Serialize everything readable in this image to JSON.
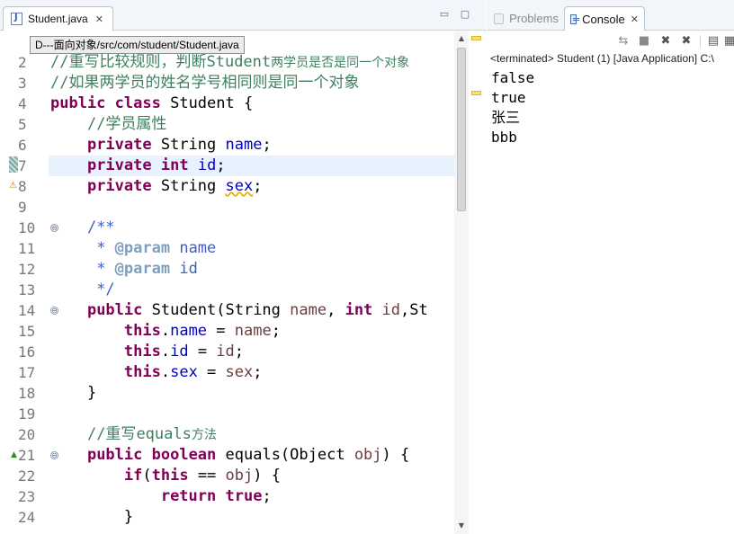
{
  "editor": {
    "tab": {
      "label": "Student.java",
      "close": "✕"
    },
    "controls": {
      "minimize": "▭",
      "maximize": "▢"
    },
    "tooltip": "D---面向对象/src/com/student/Student.java",
    "line_numbers": [
      "2",
      "3",
      "4",
      "5",
      "6",
      "7",
      "8",
      "9",
      "10",
      "11",
      "12",
      "13",
      "14",
      "15",
      "16",
      "17",
      "18",
      "19",
      "20",
      "21",
      "22",
      "23",
      "24"
    ],
    "lines": {
      "l2": {
        "slashes": "//",
        "a": "重写比较规则，判断",
        "b": "Student",
        "c": "两学员是否是同一个对象"
      },
      "l3": {
        "text": "//如果两学员的姓名学号相同则是同一个对象"
      },
      "l4": {
        "kw1": "public",
        "kw2": "class",
        "rest": " Student {"
      },
      "l5": {
        "text": "//学员属性"
      },
      "l6": {
        "kw": "private",
        "type": " String ",
        "field": "name",
        "end": ";"
      },
      "l7": {
        "kw1": "private",
        "kw2": "int",
        "field": "id",
        "end": ";"
      },
      "l8": {
        "kw": "private",
        "type": " String ",
        "field": "sex",
        "end": ";"
      },
      "l10": {
        "text": "/**"
      },
      "l11": {
        "star": " * ",
        "tag": "@param",
        "rest": " name"
      },
      "l12": {
        "star": " * ",
        "tag": "@param",
        "rest": " id"
      },
      "l13": {
        "text": " */"
      },
      "l14": {
        "kw": "public",
        "a": " Student(String ",
        "p1": "name",
        "b": ", ",
        "kw2": "int",
        "c": " ",
        "p2": "id",
        "d": ",St"
      },
      "l15": {
        "kw": "this",
        "dot": ".",
        "field": "name",
        "eq": " = ",
        "prm": "name",
        "end": ";"
      },
      "l16": {
        "kw": "this",
        "dot": ".",
        "field": "id",
        "eq": " = ",
        "prm": "id",
        "end": ";"
      },
      "l17": {
        "kw": "this",
        "dot": ".",
        "field": "sex",
        "eq": " = ",
        "prm": "sex",
        "end": ";"
      },
      "l18": {
        "text": "}"
      },
      "l20": {
        "a": "//重写",
        "b": "equals",
        "c": "方法"
      },
      "l21": {
        "kw1": "public",
        "kw2": "boolean",
        "a": " equals(Object ",
        "p": "obj",
        "b": ") {"
      },
      "l22": {
        "kw1": "if",
        "a": "(",
        "kw2": "this",
        "b": " == ",
        "p": "obj",
        "c": ") {"
      },
      "l23": {
        "kw1": "return",
        "kw2": "true",
        "end": ";"
      },
      "l24": {
        "text": "}"
      }
    }
  },
  "console": {
    "tabs": [
      {
        "label": "Problems"
      },
      {
        "label": "Console",
        "close": "✕"
      }
    ],
    "status": "<terminated> Student (1) [Java Application] C:\\",
    "output": [
      "false",
      "true",
      "张三",
      "bbb"
    ]
  },
  "icons": {
    "fold": "⊖",
    "override": "▲",
    "warning": "⚠",
    "scroll_up": "▲",
    "scroll_down": "▼",
    "tb_pin": "⇆",
    "tb_stop": "■",
    "tb_remove": "✖",
    "tb_remove_all": "✖",
    "tb_clear": "▤",
    "tb_scroll_lock": "▦"
  }
}
